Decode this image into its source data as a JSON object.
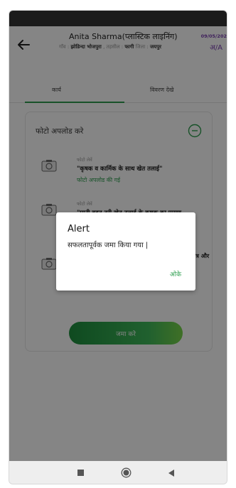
{
  "header": {
    "title": "Anita Sharma(प्लास्टिक लाइनिंग)",
    "village_label": "गाँव :",
    "village": "झोडिन्दा भोजपुरा",
    "tehsil_label": ", तहसील :",
    "tehsil": "फागी",
    "district_label": "जिला :",
    "district": "जयपुर",
    "date": "09/05/202",
    "code": "अ/A"
  },
  "tabs": [
    {
      "label": "कार्य"
    },
    {
      "label": "विवरण देखे"
    }
  ],
  "card": {
    "title": "फोटो अपलोड करे",
    "items": [
      {
        "pre": "फोटो लेवें",
        "title": "\"कृषक व कार्मिक के साथ खेत तलाई\"",
        "status": "फोटो अपलोड की गई"
      },
      {
        "pre": "फोटो लेवें",
        "title": "\"पानी बहुत तरी खेत तलाई के कृषक का प्रमाण",
        "status": ""
      },
      {
        "pre": "",
        "title": "",
        "tail": "पत्र और",
        "status": ""
      }
    ],
    "submit_label": "जमा करे"
  },
  "dialog": {
    "title": "Alert",
    "message": "सफलतापूर्वक जमा किया गया |",
    "ok_label": "ओके"
  },
  "colors": {
    "accent_green": "#2e9e4f",
    "code_purple": "#7a3fb0"
  },
  "icons": {
    "back": "arrow-left-icon",
    "collapse": "minus-circle-icon",
    "camera": "camera-icon",
    "nav_recent": "square-icon",
    "nav_home": "circle-icon",
    "nav_back": "triangle-back-icon"
  }
}
